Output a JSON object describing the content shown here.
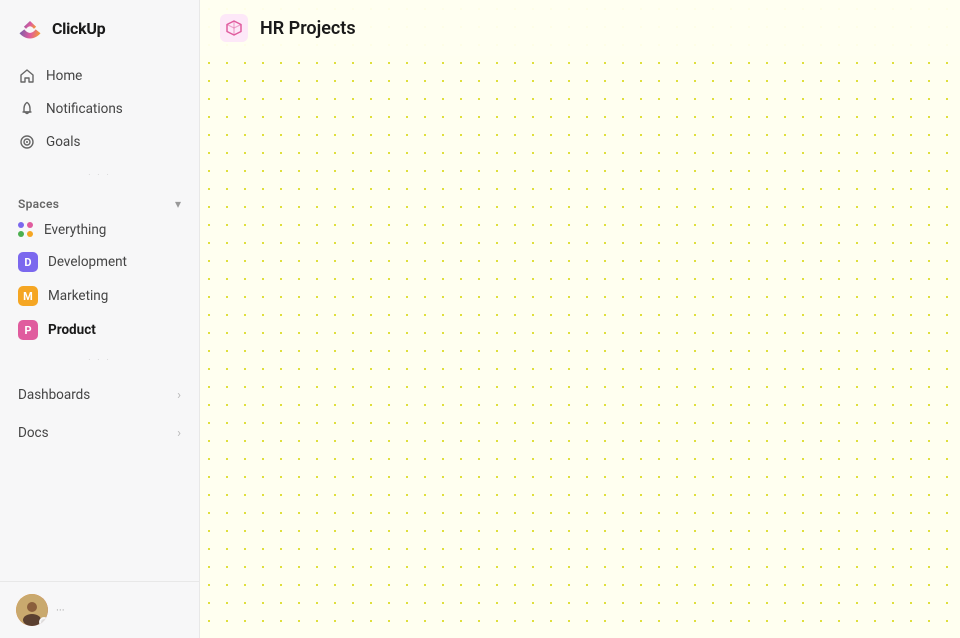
{
  "app": {
    "name": "ClickUp"
  },
  "sidebar": {
    "logo_text": "ClickUp",
    "nav_items": [
      {
        "id": "home",
        "label": "Home",
        "icon": "home-icon"
      },
      {
        "id": "notifications",
        "label": "Notifications",
        "icon": "bell-icon"
      },
      {
        "id": "goals",
        "label": "Goals",
        "icon": "goals-icon"
      }
    ],
    "spaces_label": "Spaces",
    "spaces_chevron": "▾",
    "spaces": [
      {
        "id": "everything",
        "label": "Everything",
        "icon": "grid-icon",
        "color": null
      },
      {
        "id": "development",
        "label": "Development",
        "icon": "D",
        "color": "#7b68ee"
      },
      {
        "id": "marketing",
        "label": "Marketing",
        "icon": "M",
        "color": "#f5a623"
      },
      {
        "id": "product",
        "label": "Product",
        "icon": "P",
        "color": "#e05c9e",
        "active": true
      }
    ],
    "expandable": [
      {
        "id": "dashboards",
        "label": "Dashboards"
      },
      {
        "id": "docs",
        "label": "Docs"
      }
    ]
  },
  "main": {
    "project_title": "HR Projects",
    "project_icon": "cube-icon"
  },
  "dots_colors": {
    "d1": "#7b68ee",
    "d2": "#e05c9e",
    "d3": "#4caf50",
    "d4": "#f5a623"
  }
}
